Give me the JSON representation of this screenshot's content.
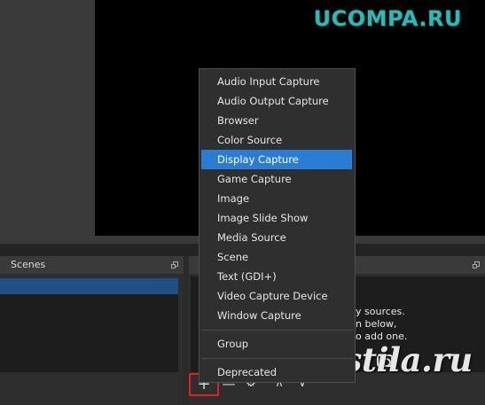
{
  "watermark": {
    "text": "UCOMPA.RU",
    "color": "#2fb8b6"
  },
  "scenes_dock": {
    "title": "Scenes",
    "float_icon": "float-window-icon"
  },
  "sources_dock": {
    "hint_lines": [
      "y sources.",
      "n below,",
      "o add one."
    ],
    "toolbar": {
      "add": "+",
      "remove": "—",
      "properties": "⚙",
      "move_up": "∧",
      "move_down": "∨"
    }
  },
  "context_menu": {
    "items": [
      "Audio Input Capture",
      "Audio Output Capture",
      "Browser",
      "Color Source",
      "Display Capture",
      "Game Capture",
      "Image",
      "Image Slide Show",
      "Media Source",
      "Scene",
      "Text (GDI+)",
      "Video Capture Device",
      "Window Capture"
    ],
    "active_item": "Display Capture",
    "group_item": "Group",
    "deprecated_item": "Deprecated",
    "active_color": "#2a7dd4"
  },
  "postila_watermark": {
    "text": "postila.ru"
  },
  "highlight_color": "#e0211f"
}
